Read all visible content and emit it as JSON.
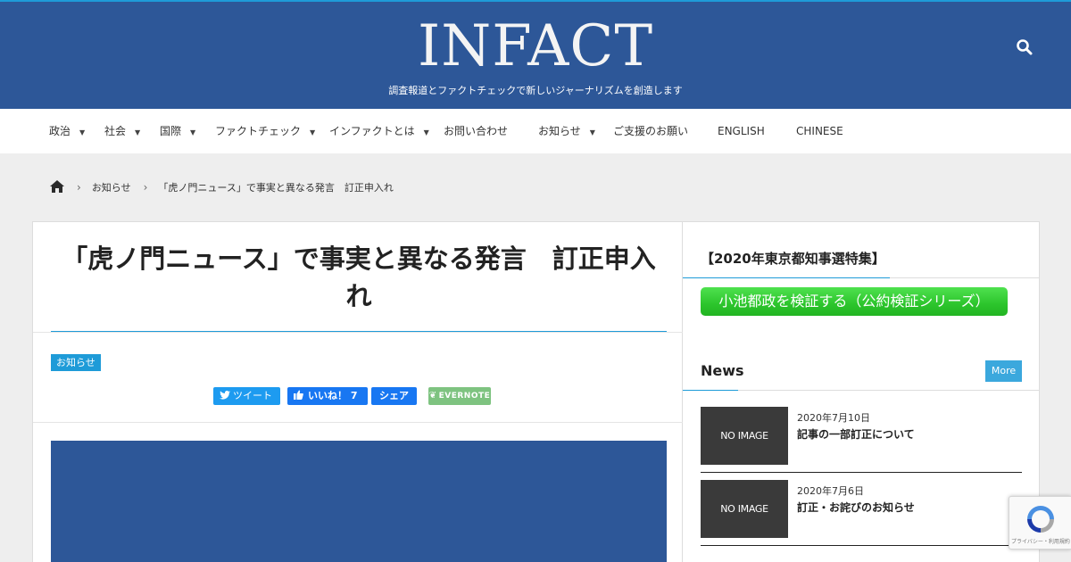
{
  "header": {
    "logo": "INFACT",
    "tagline": "調査報道とファクトチェックで新しいジャーナリズムを創造します"
  },
  "nav": {
    "items": [
      {
        "label": "政治"
      },
      {
        "label": "社会"
      },
      {
        "label": "国際"
      },
      {
        "label": "ファクトチェック"
      },
      {
        "label": "インファクトとは"
      },
      {
        "label": "お問い合わせ"
      },
      {
        "label": "お知らせ"
      },
      {
        "label": "ご支援のお願い"
      },
      {
        "label": "ENGLISH"
      },
      {
        "label": "CHINESE"
      }
    ]
  },
  "breadcrumb": {
    "items": [
      "お知らせ",
      "「虎ノ門ニュース」で事実と異なる発言　訂正申入れ"
    ]
  },
  "article": {
    "title": "「虎ノ門ニュース」で事実と異なる発言　訂正申入れ",
    "category": "お知らせ",
    "share": {
      "tweet": "ツイート",
      "like": "いいね！ 7",
      "share": "シェア",
      "evernote": "EVERNOTE"
    }
  },
  "sidebar": {
    "widget_title": "【2020年東京都知事選特集】",
    "green_button": "小池都政を検証する（公約検証シリーズ）",
    "news_title": "News",
    "more_label": "More",
    "news": [
      {
        "thumb": "NO IMAGE",
        "date": "2020年7月10日",
        "headline": "記事の一部訂正について"
      },
      {
        "thumb": "NO IMAGE",
        "date": "2020年7月6日",
        "headline": "訂正・お詫びのお知らせ"
      }
    ]
  },
  "recaptcha": {
    "text": "プライバシー・利用規約"
  }
}
